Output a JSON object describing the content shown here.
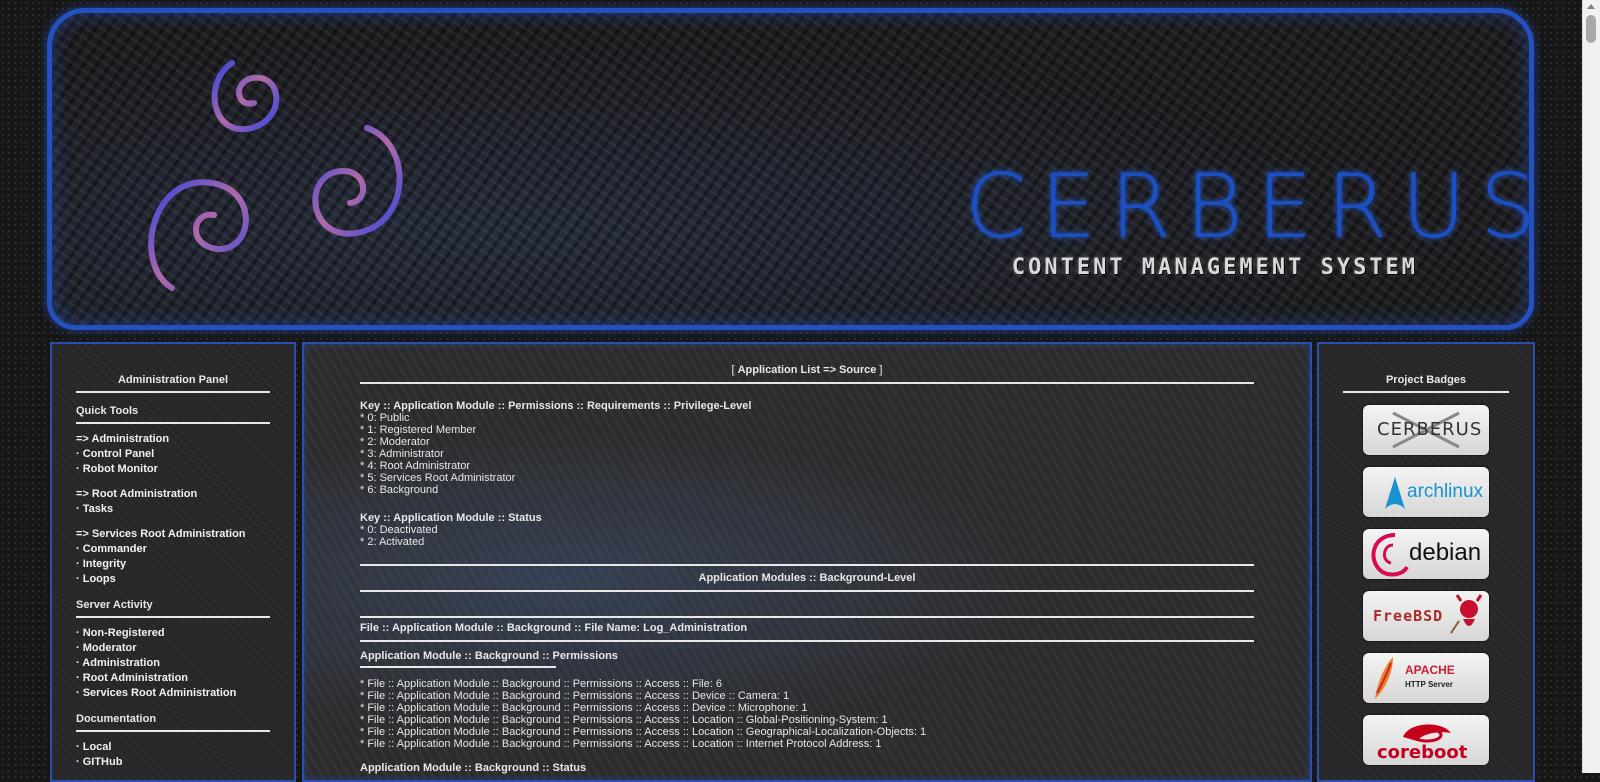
{
  "banner": {
    "title": "CERBERUS",
    "subtitle": "CONTENT MANAGEMENT SYSTEM",
    "logo_icon": "triple-spiral-icon",
    "accent_color": "#2450c0"
  },
  "left_panel": {
    "title": "Administration Panel",
    "quick_tools": {
      "heading": "Quick Tools",
      "groups": [
        {
          "header": "=> Administration",
          "items": [
            "· Control Panel",
            "· Robot Monitor"
          ]
        },
        {
          "header": "=> Root Administration",
          "items": [
            "· Tasks"
          ]
        },
        {
          "header": "=> Services Root Administration",
          "items": [
            "· Commander",
            "· Integrity",
            "· Loops"
          ]
        }
      ]
    },
    "server_activity": {
      "heading": "Server Activity",
      "items": [
        "· Non-Registered",
        "· Moderator",
        "· Administration",
        "· Root Administration",
        "· Services Root Administration"
      ]
    },
    "documentation": {
      "heading": "Documentation",
      "items": [
        "· Local",
        "· GITHub"
      ]
    }
  },
  "center": {
    "breadcrumb_open": "[ ",
    "breadcrumb": "Application List => Source",
    "breadcrumb_close": " ]",
    "privilege_key": {
      "title": "Key :: Application Module :: Permissions :: Requirements :: Privilege-Level",
      "items": [
        "* 0: Public",
        "* 1: Registered Member",
        "* 2: Moderator",
        "* 3: Administrator",
        "* 4: Root Administrator",
        "* 5: Services Root Administrator",
        "* 6: Background"
      ]
    },
    "status_key": {
      "title": "Key :: Application Module :: Status",
      "items": [
        "* 0: Deactivated",
        "* 2: Activated"
      ]
    },
    "section_title": "Application Modules :: Background-Level",
    "file_title": "File :: Application Module :: Background :: File Name: Log_Administration",
    "permissions_title": "Application Module :: Background :: Permissions",
    "permissions": [
      "* File :: Application Module :: Background :: Permissions :: Access :: File: 6",
      "* File :: Application Module :: Background :: Permissions :: Access :: Device :: Camera: 1",
      "* File :: Application Module :: Background :: Permissions :: Access :: Device :: Microphone: 1",
      "* File :: Application Module :: Background :: Permissions :: Access :: Location :: Global-Positioning-System: 1",
      "* File :: Application Module :: Background :: Permissions :: Access :: Location :: Geographical-Localization-Objects: 1",
      "* File :: Application Module :: Background :: Permissions :: Access :: Location :: Internet Protocol Address: 1"
    ],
    "status_title": "Application Module :: Background :: Status"
  },
  "right_panel": {
    "title": "Project Badges",
    "badges": [
      {
        "label": "CERBERUS",
        "icon": "cerberus-badge-icon",
        "color": "#333333"
      },
      {
        "label": "archlinux",
        "icon": "archlinux-badge-icon",
        "color": "#1793d1"
      },
      {
        "label": "debian",
        "icon": "debian-badge-icon",
        "color": "#d70a53"
      },
      {
        "label": "FreeBSD",
        "icon": "freebsd-badge-icon",
        "color": "#ab2b28"
      },
      {
        "label": "APACHE",
        "sublabel": "HTTP Server",
        "icon": "apache-feather-icon",
        "color": "#c92037"
      },
      {
        "label": "coreboot",
        "icon": "coreboot-badge-icon",
        "color": "#c4001c"
      }
    ]
  }
}
